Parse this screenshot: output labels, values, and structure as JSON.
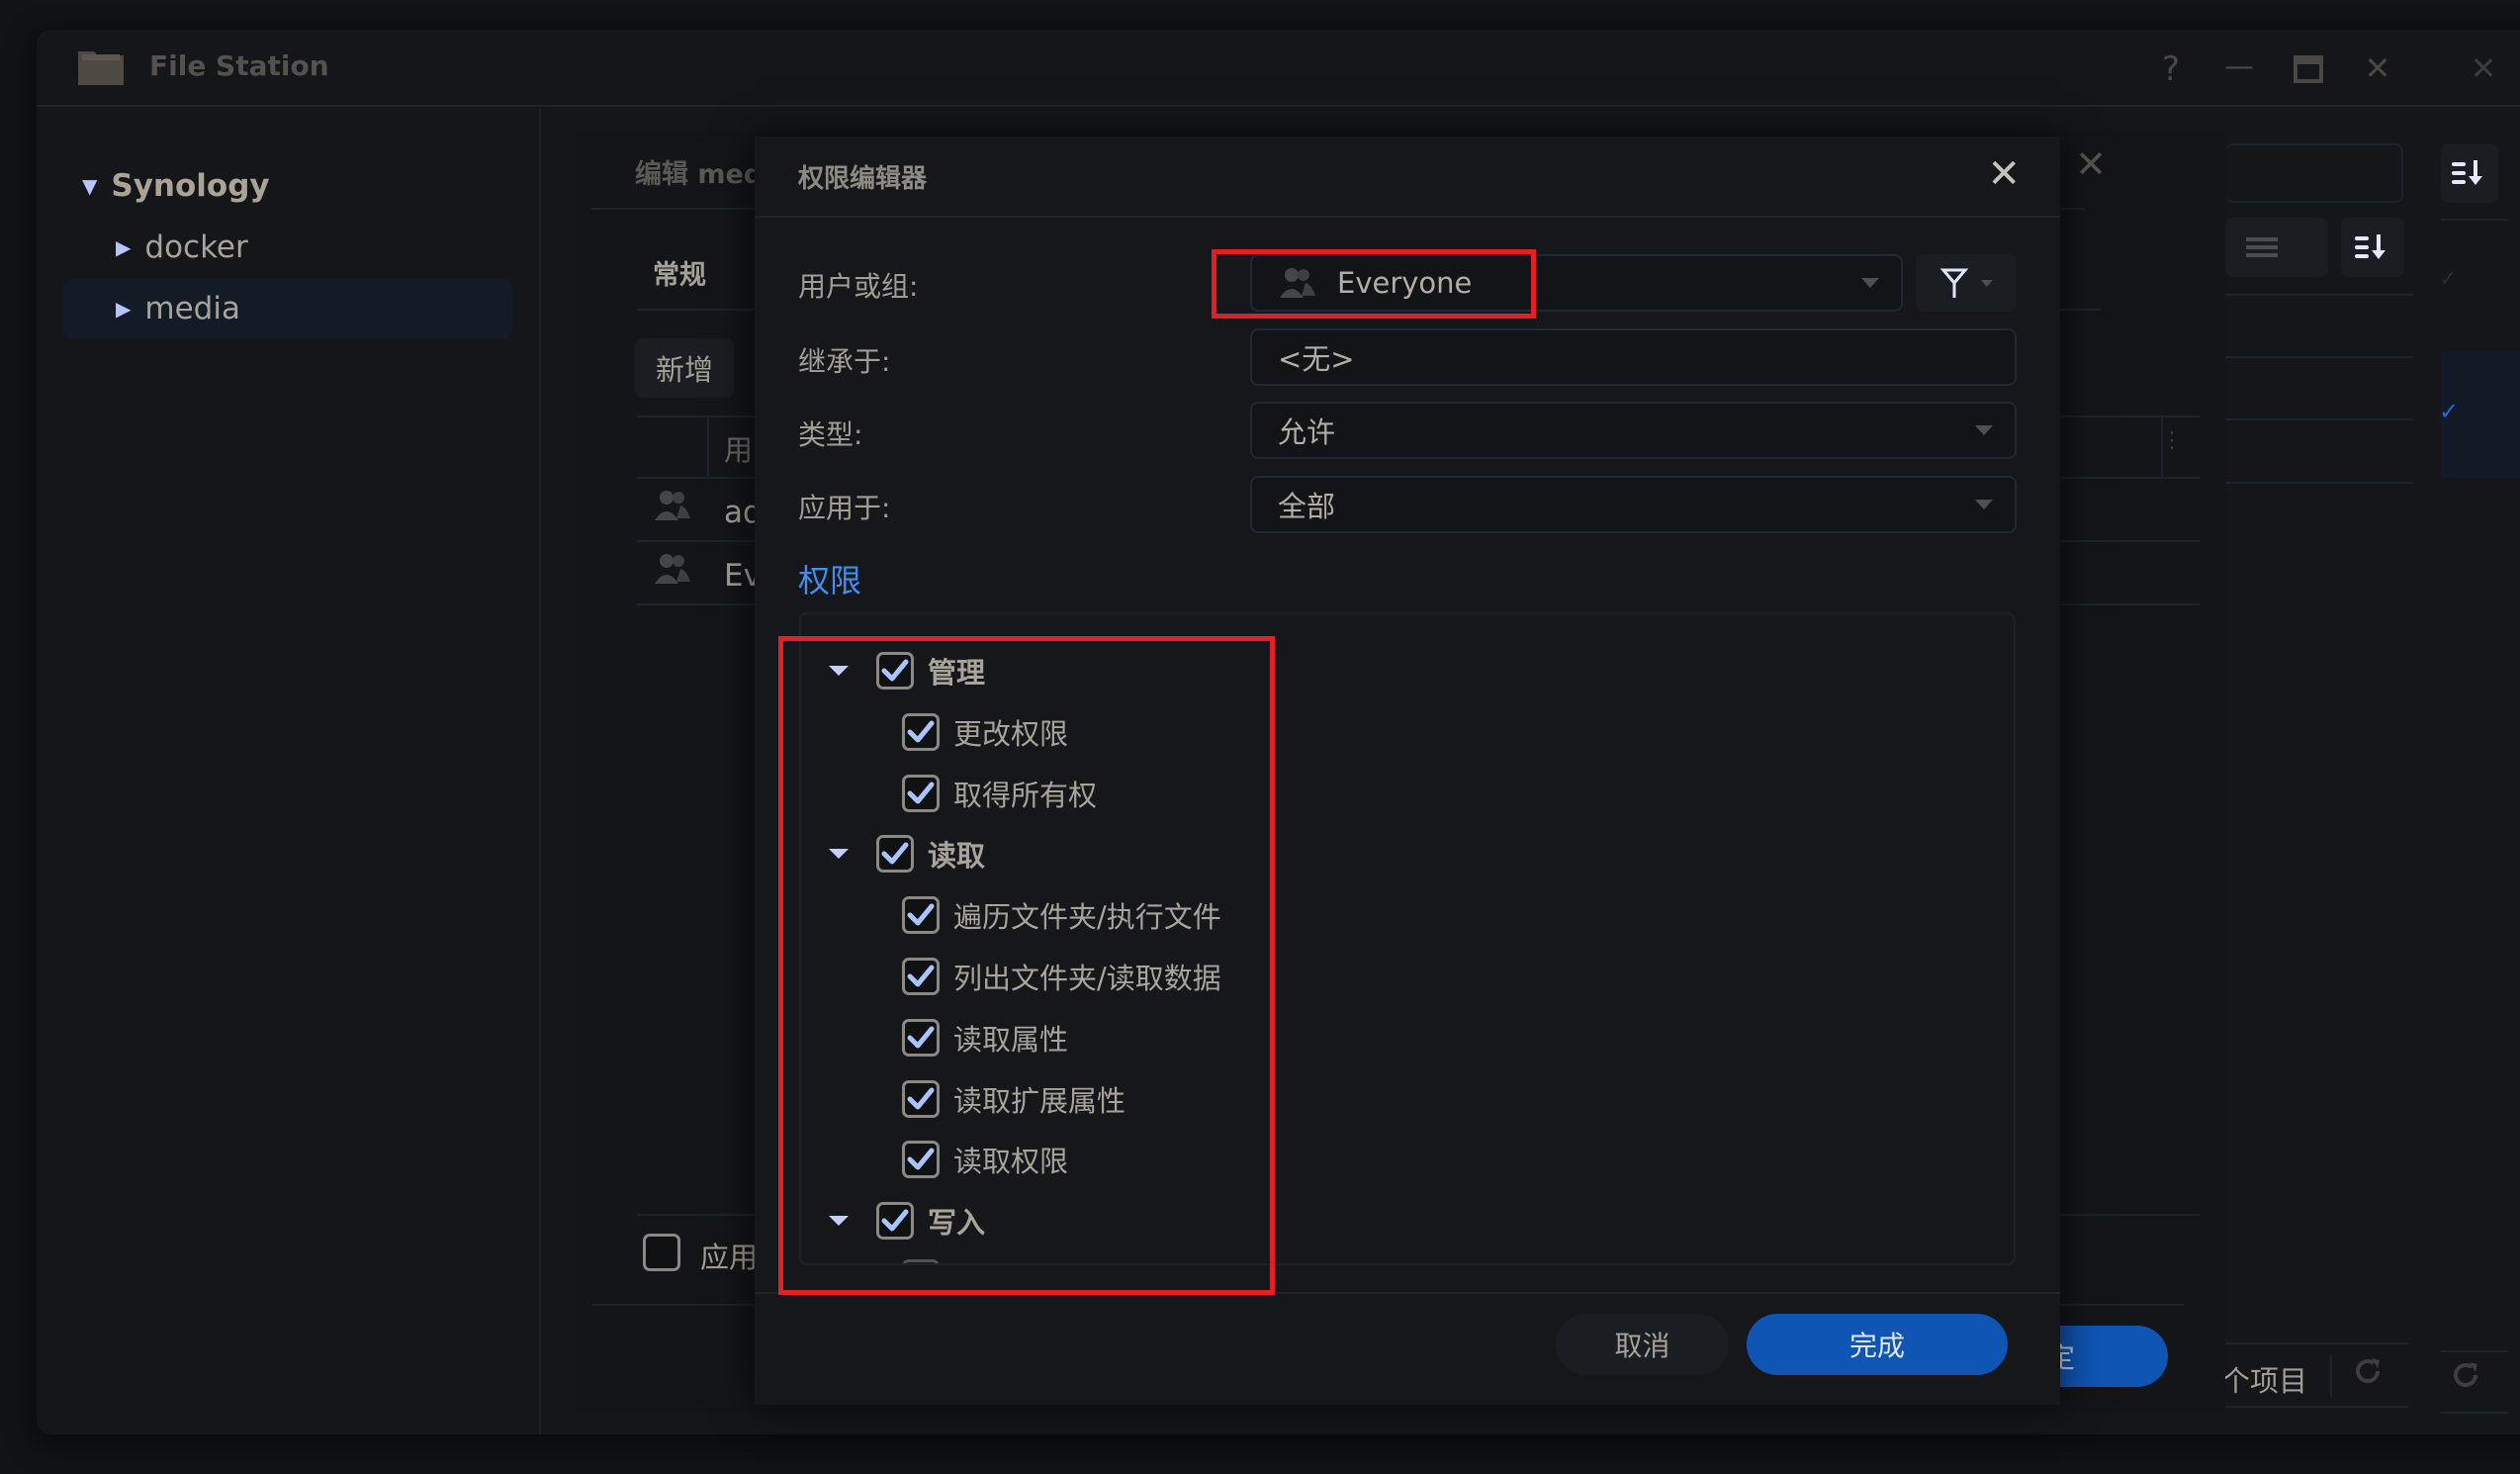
{
  "window": {
    "app_title": "File Station",
    "controls": {
      "help": "?",
      "minimize": "—",
      "maximize": "▭",
      "close": "✕",
      "outer_close": "✕"
    }
  },
  "sidebar": {
    "root": {
      "label": "Synology",
      "expanded": true
    },
    "items": [
      {
        "label": "docker",
        "selected": false
      },
      {
        "label": "media",
        "selected": true
      }
    ]
  },
  "edit_dialog": {
    "title_partial": "编辑 med",
    "tab_general": "常规",
    "add_button": "新增",
    "table_header_partial": "用",
    "rows_partial": [
      "ad",
      "Ev"
    ],
    "apply_checkbox_label_partial": "应用",
    "apply_checked": false,
    "primary_button_partial": "定",
    "item_count_suffix": "个项目"
  },
  "perm_dialog": {
    "title": "权限编辑器",
    "labels": {
      "user_or_group": "用户或组:",
      "inherited_from": "继承于:",
      "type": "类型:",
      "apply_to": "应用于:"
    },
    "values": {
      "user_or_group": "Everyone",
      "inherited_from": "<无>",
      "type": "允许",
      "apply_to": "全部"
    },
    "section_title": "权限",
    "permissions": [
      {
        "label": "管理",
        "group": true,
        "checked": true,
        "expanded": true
      },
      {
        "label": "更改权限",
        "group": false,
        "checked": true
      },
      {
        "label": "取得所有权",
        "group": false,
        "checked": true
      },
      {
        "label": "读取",
        "group": true,
        "checked": true,
        "expanded": true
      },
      {
        "label": "遍历文件夹/执行文件",
        "group": false,
        "checked": true
      },
      {
        "label": "列出文件夹/读取数据",
        "group": false,
        "checked": true
      },
      {
        "label": "读取属性",
        "group": false,
        "checked": true
      },
      {
        "label": "读取扩展属性",
        "group": false,
        "checked": true
      },
      {
        "label": "读取权限",
        "group": false,
        "checked": true
      },
      {
        "label": "写入",
        "group": true,
        "checked": true,
        "expanded": true
      }
    ],
    "cancel_label": "取消",
    "done_label": "完成"
  },
  "colors": {
    "accent": "#0f55b4",
    "link": "#3e8ff0",
    "highlight_box": "#e51e26"
  }
}
